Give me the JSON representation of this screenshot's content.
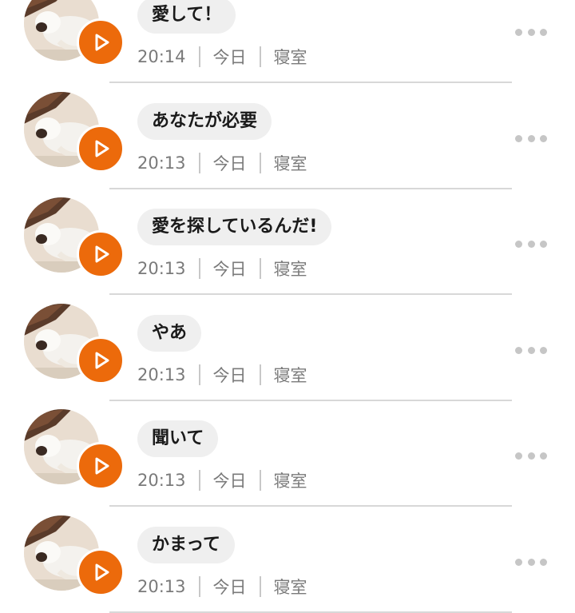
{
  "theme": {
    "accent": "#ec6a0b",
    "bubble_bg": "#efefef",
    "meta_text": "#7a7a7a",
    "divider": "#d8d8d8"
  },
  "icons": {
    "play": "play-icon",
    "more": "more-dots-icon",
    "avatar": "cat-photo"
  },
  "messages": [
    {
      "text": "愛して！",
      "time": "20:14",
      "day": "今日",
      "room": "寝室"
    },
    {
      "text": "あなたが必要",
      "time": "20:13",
      "day": "今日",
      "room": "寝室"
    },
    {
      "text": "愛を探しているんだ!",
      "time": "20:13",
      "day": "今日",
      "room": "寝室"
    },
    {
      "text": "やあ",
      "time": "20:13",
      "day": "今日",
      "room": "寝室"
    },
    {
      "text": "聞いて",
      "time": "20:13",
      "day": "今日",
      "room": "寝室"
    },
    {
      "text": "かまって",
      "time": "20:13",
      "day": "今日",
      "room": "寝室"
    }
  ]
}
